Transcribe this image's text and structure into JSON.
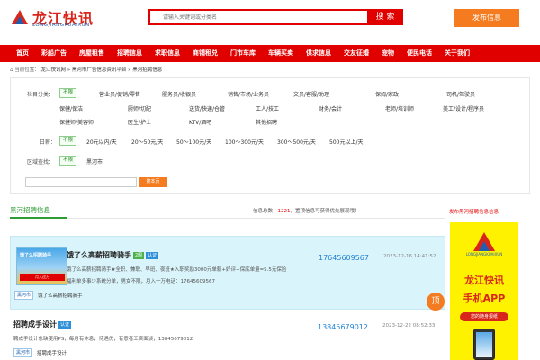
{
  "header": {
    "logo_title": "龙江快讯",
    "logo_sub": "LONGJIANGKUAIXUN",
    "search_placeholder": "请输入关键词或分类名",
    "search_button": "搜 索",
    "post_button": "发布信息"
  },
  "nav": {
    "items": [
      "首页",
      "彩船广告",
      "房屋租售",
      "招聘信息",
      "求职信息",
      "商铺租兑",
      "门市车库",
      "车辆买卖",
      "供求信息",
      "交友征婚",
      "宠物",
      "便民电话",
      "关于我们"
    ]
  },
  "breadcrumb": {
    "prefix": "当前位置：",
    "path": "龙江快讯网 » 黑河市广告信息资讯平台 » 黑河招聘信息"
  },
  "filters": {
    "category_label": "栏目分类：",
    "no_limit": "不限",
    "categories_row1": [
      "营业员/促销/零售",
      "服务员/收银员",
      "销售/市场/业务员",
      "文员/客服/助理",
      "保姆/家政",
      "司机/驾驶员"
    ],
    "categories_row2": [
      "保健/保洁",
      "厨师/切配",
      "送货/快递/仓管",
      "工人/技工",
      "财务/会计",
      "老师/培训师",
      "美工/设计/程序员"
    ],
    "categories_row3": [
      "保健师/美容师",
      "医生/护士",
      "KTV/酒吧",
      "其他招聘"
    ],
    "salary_label": "日薪：",
    "salaries": [
      "20元以内/天",
      "20～50元/天",
      "50～100元/天",
      "100～300元/天",
      "300～500元/天",
      "500元以上/天"
    ],
    "area_label": "区域查找：",
    "areas": [
      "黑河市"
    ],
    "search_button": "搜本页"
  },
  "section": {
    "title": "黑河招聘信息",
    "count_prefix": "信息总数：",
    "count": "1221",
    "count_suffix": "，置顶信息可获得优先展现哦！",
    "ad_link": "发布黑河招聘信息信息"
  },
  "listings": [
    {
      "title": "饿了么高薪招聘骑手",
      "badge_2": "2图",
      "badge_auth": "认证",
      "phone": "17645609567",
      "date": "2023-12-16 14:41:52",
      "desc": "饿了么高薪招聘骑手★全职、兼职、早班、夜班★入职奖励3000元单薪+好评+保底单量=5.5元保险",
      "desc2": "福利单多事少系统分单，男女不限，月入一万电话：17645609567",
      "tag": "黑河市",
      "sub": "饿了么高薪招聘骑手",
      "thumb_text": "饿了么招聘骑手",
      "thumb_banner": "月入过万",
      "top_label": "顶"
    },
    {
      "title": "招聘成手设计",
      "badge_auth": "认证",
      "phone": "13845679012",
      "date": "2023-12-22 08:52:33",
      "desc": "聘成手设计急缺使用PS，每月有休息，待遇优，有意者工资面谈，13845679012",
      "tag": "黑河市",
      "sub": "招聘成手设计"
    }
  ],
  "ad": {
    "logo_text": "LONGJIANGKUAIXUN",
    "title": "龙江快讯",
    "subtitle": "手机APP",
    "pill": "您的随身报纸"
  },
  "colors": {
    "brand_red": "#e10000",
    "orange": "#f47b20",
    "green": "#2e9c33",
    "link_blue": "#1f7fd4"
  }
}
